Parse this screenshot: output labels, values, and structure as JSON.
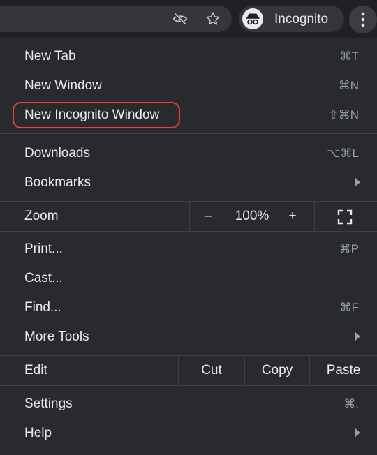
{
  "toolbar": {
    "incognito_label": "Incognito",
    "icons": [
      "eye-off-icon",
      "star-icon",
      "incognito-icon",
      "more-vert-icon"
    ]
  },
  "menu": {
    "new_tab": {
      "label": "New Tab",
      "shortcut": "⌘T"
    },
    "new_window": {
      "label": "New Window",
      "shortcut": "⌘N"
    },
    "new_incognito": {
      "label": "New Incognito Window",
      "shortcut": "⇧⌘N"
    },
    "downloads": {
      "label": "Downloads",
      "shortcut": "⌥⌘L"
    },
    "bookmarks": {
      "label": "Bookmarks"
    },
    "zoom": {
      "label": "Zoom",
      "minus": "–",
      "value": "100%",
      "plus": "+"
    },
    "print": {
      "label": "Print...",
      "shortcut": "⌘P"
    },
    "cast": {
      "label": "Cast..."
    },
    "find": {
      "label": "Find...",
      "shortcut": "⌘F"
    },
    "more_tools": {
      "label": "More Tools"
    },
    "edit": {
      "label": "Edit",
      "cut": "Cut",
      "copy": "Copy",
      "paste": "Paste"
    },
    "settings": {
      "label": "Settings",
      "shortcut": "⌘,"
    },
    "help": {
      "label": "Help"
    }
  },
  "colors": {
    "menu_bg": "#292a2d",
    "text": "#e8eaed",
    "shortcut": "#9aa0a6",
    "highlight": "#e8432f"
  }
}
